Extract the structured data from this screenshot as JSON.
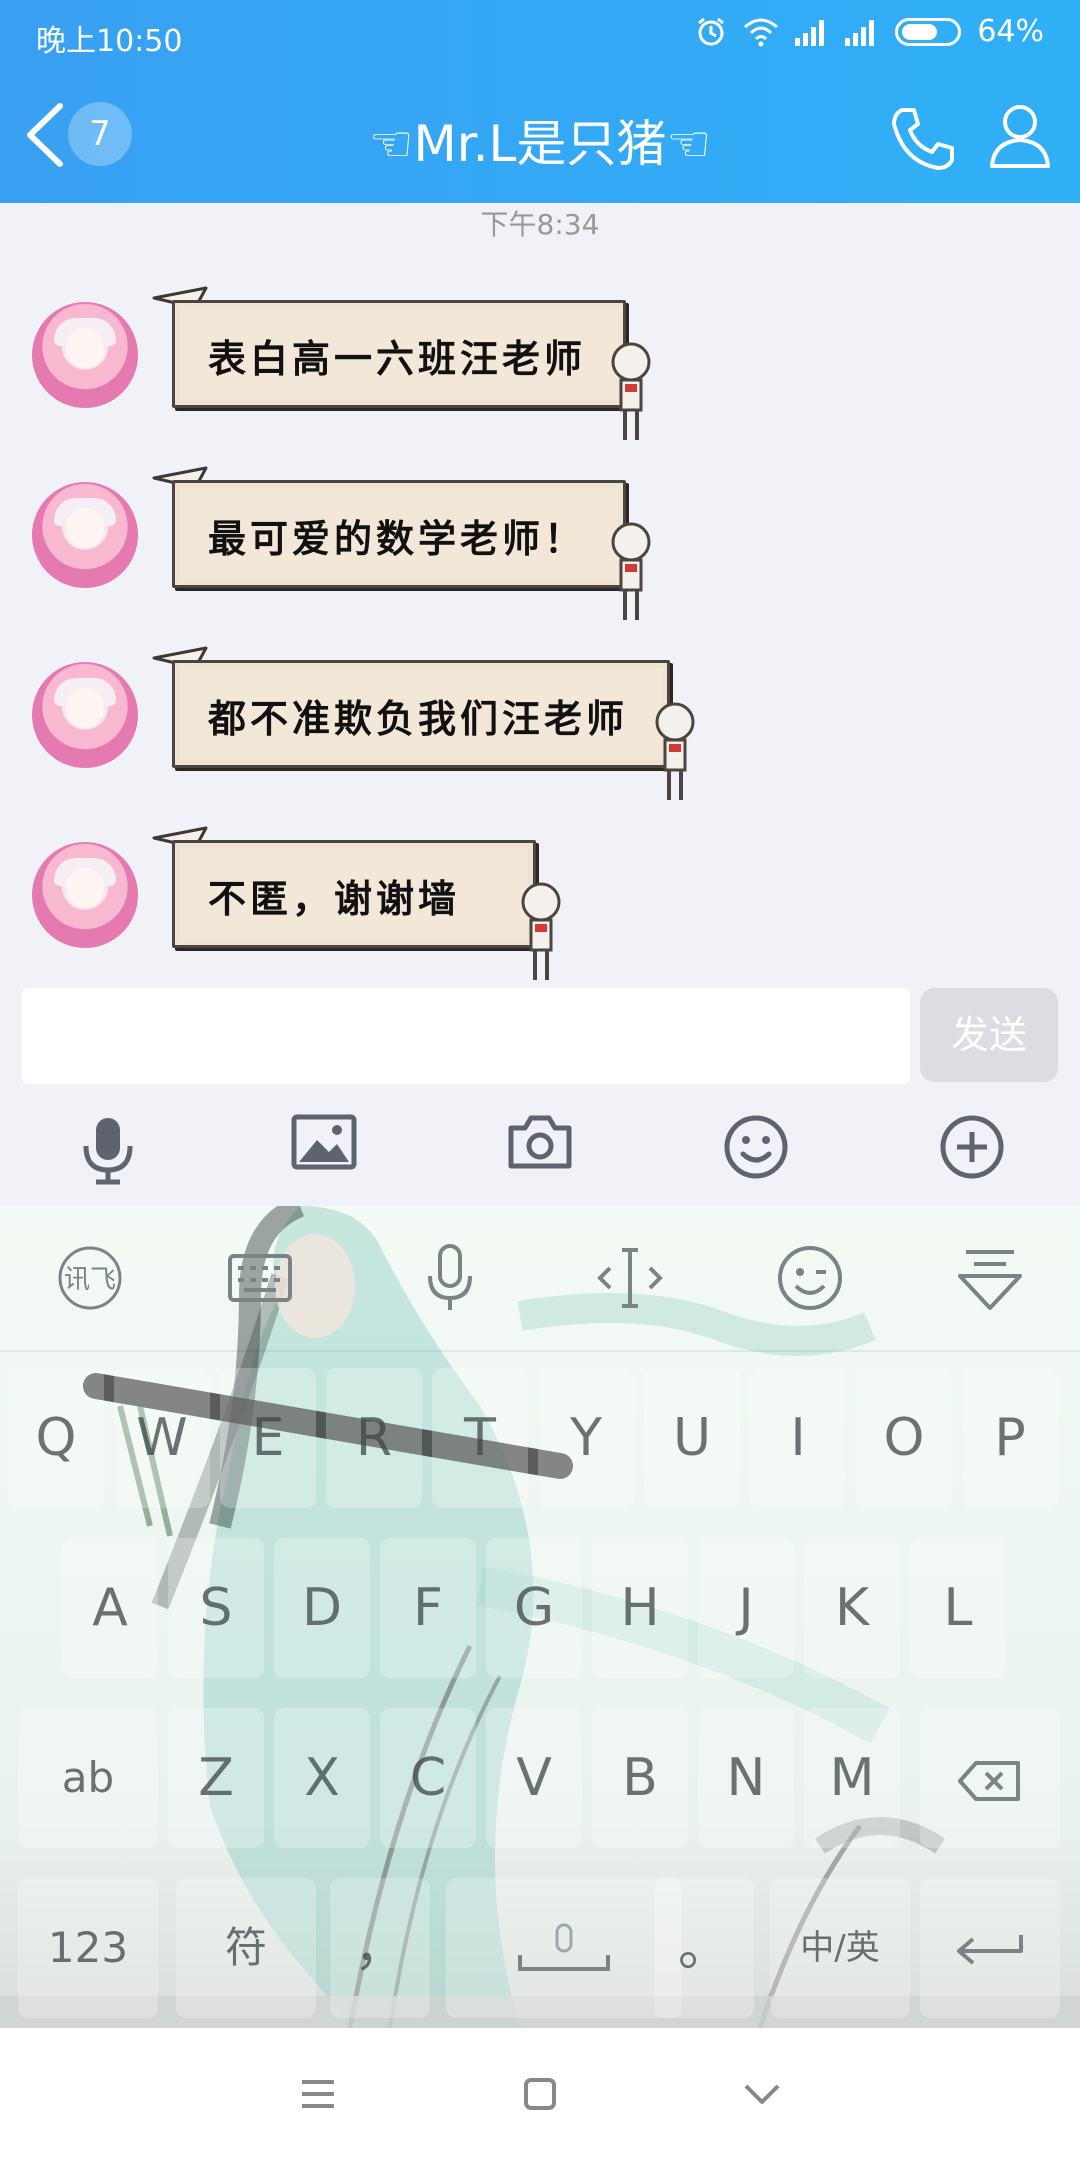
{
  "status_bar": {
    "time": "晚上10:50",
    "battery": "64%",
    "battery_level": 0.64
  },
  "header": {
    "back_badge": "7",
    "title": "☜Mr.L是只猪☜",
    "accent_color": "#39a0f2"
  },
  "chat": {
    "timestamp": "下午8:34",
    "messages": [
      {
        "text": "表白高一六班汪老师"
      },
      {
        "text": "最可爱的数学老师！"
      },
      {
        "text": "都不准欺负我们汪老师"
      },
      {
        "text": "不匿，谢谢墙"
      }
    ]
  },
  "composer": {
    "input_value": "",
    "send_label": "发送"
  },
  "toolbar": {
    "icons": [
      "microphone-icon",
      "image-icon",
      "camera-icon",
      "emoji-icon",
      "plus-icon"
    ]
  },
  "keyboard": {
    "top_icons": [
      "ifly-logo-icon",
      "keyboard-icon",
      "voice-icon",
      "cursor-icon",
      "emoji-icon",
      "collapse-icon"
    ],
    "ifly_label": "讯飞",
    "row1": [
      "Q",
      "W",
      "E",
      "R",
      "T",
      "Y",
      "U",
      "I",
      "O",
      "P"
    ],
    "row2": [
      "A",
      "S",
      "D",
      "F",
      "G",
      "H",
      "J",
      "K",
      "L"
    ],
    "row3": {
      "shift": "ab",
      "keys": [
        "Z",
        "X",
        "C",
        "V",
        "B",
        "N",
        "M"
      ]
    },
    "row4": {
      "num": "123",
      "sym": "符",
      "comma": "，",
      "period": "。",
      "lang": "中/英"
    }
  },
  "navbar": {
    "icons": [
      "menu-icon",
      "home-icon",
      "back-down-icon"
    ]
  }
}
